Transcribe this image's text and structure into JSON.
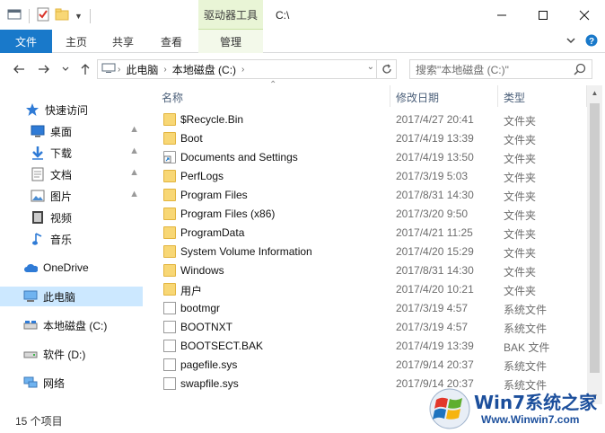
{
  "window": {
    "title": "C:\\",
    "tool_tab_title": "驱动器工具"
  },
  "ribbon": {
    "tabs": [
      {
        "label": "文件"
      },
      {
        "label": "主页"
      },
      {
        "label": "共享"
      },
      {
        "label": "查看"
      },
      {
        "label": "管理"
      }
    ]
  },
  "address": {
    "crumbs": [
      "此电脑",
      "本地磁盘 (C:)"
    ],
    "search_placeholder": "搜索\"本地磁盘 (C:)\""
  },
  "nav": {
    "items": [
      {
        "label": "快速访问",
        "icon": "star-icon"
      },
      {
        "label": "桌面",
        "icon": "desktop-icon",
        "pinned": true
      },
      {
        "label": "下载",
        "icon": "download-icon",
        "pinned": true
      },
      {
        "label": "文档",
        "icon": "document-icon",
        "pinned": true
      },
      {
        "label": "图片",
        "icon": "pictures-icon",
        "pinned": true
      },
      {
        "label": "视频",
        "icon": "video-icon"
      },
      {
        "label": "音乐",
        "icon": "music-icon"
      },
      {
        "label": "OneDrive",
        "icon": "cloud-icon"
      },
      {
        "label": "此电脑",
        "icon": "computer-icon",
        "selected": true
      },
      {
        "label": "本地磁盘 (C:)",
        "icon": "drive-icon"
      },
      {
        "label": "软件 (D:)",
        "icon": "drive-icon"
      },
      {
        "label": "网络",
        "icon": "network-icon"
      }
    ]
  },
  "columns": {
    "name": "名称",
    "date": "修改日期",
    "type": "类型"
  },
  "files": [
    {
      "name": "$Recycle.Bin",
      "date": "2017/4/27 20:41",
      "type": "文件夹",
      "kind": "folder"
    },
    {
      "name": "Boot",
      "date": "2017/4/19 13:39",
      "type": "文件夹",
      "kind": "folder"
    },
    {
      "name": "Documents and Settings",
      "date": "2017/4/19 13:50",
      "type": "文件夹",
      "kind": "shortcut"
    },
    {
      "name": "PerfLogs",
      "date": "2017/3/19 5:03",
      "type": "文件夹",
      "kind": "folder"
    },
    {
      "name": "Program Files",
      "date": "2017/8/31 14:30",
      "type": "文件夹",
      "kind": "folder"
    },
    {
      "name": "Program Files (x86)",
      "date": "2017/3/20 9:50",
      "type": "文件夹",
      "kind": "folder"
    },
    {
      "name": "ProgramData",
      "date": "2017/4/21 11:25",
      "type": "文件夹",
      "kind": "folder"
    },
    {
      "name": "System Volume Information",
      "date": "2017/4/20 15:29",
      "type": "文件夹",
      "kind": "folder"
    },
    {
      "name": "Windows",
      "date": "2017/8/31 14:30",
      "type": "文件夹",
      "kind": "folder"
    },
    {
      "name": "用户",
      "date": "2017/4/20 10:21",
      "type": "文件夹",
      "kind": "folder"
    },
    {
      "name": "bootmgr",
      "date": "2017/3/19 4:57",
      "type": "系统文件",
      "kind": "file"
    },
    {
      "name": "BOOTNXT",
      "date": "2017/3/19 4:57",
      "type": "系统文件",
      "kind": "file"
    },
    {
      "name": "BOOTSECT.BAK",
      "date": "2017/4/19 13:39",
      "type": "BAK 文件",
      "kind": "file"
    },
    {
      "name": "pagefile.sys",
      "date": "2017/9/14 20:37",
      "type": "系统文件",
      "kind": "file"
    },
    {
      "name": "swapfile.sys",
      "date": "2017/9/14 20:37",
      "type": "系统文件",
      "kind": "file"
    }
  ],
  "status": {
    "item_count": "15 个项目"
  },
  "watermark": {
    "title": "Win7系统之家",
    "url": "Www.Winwin7.com"
  },
  "colors": {
    "file_tab": "#1979ca",
    "manage_tab": "#e9f5d6",
    "selected_nav": "#cce8ff",
    "folder": "#f8d775"
  }
}
